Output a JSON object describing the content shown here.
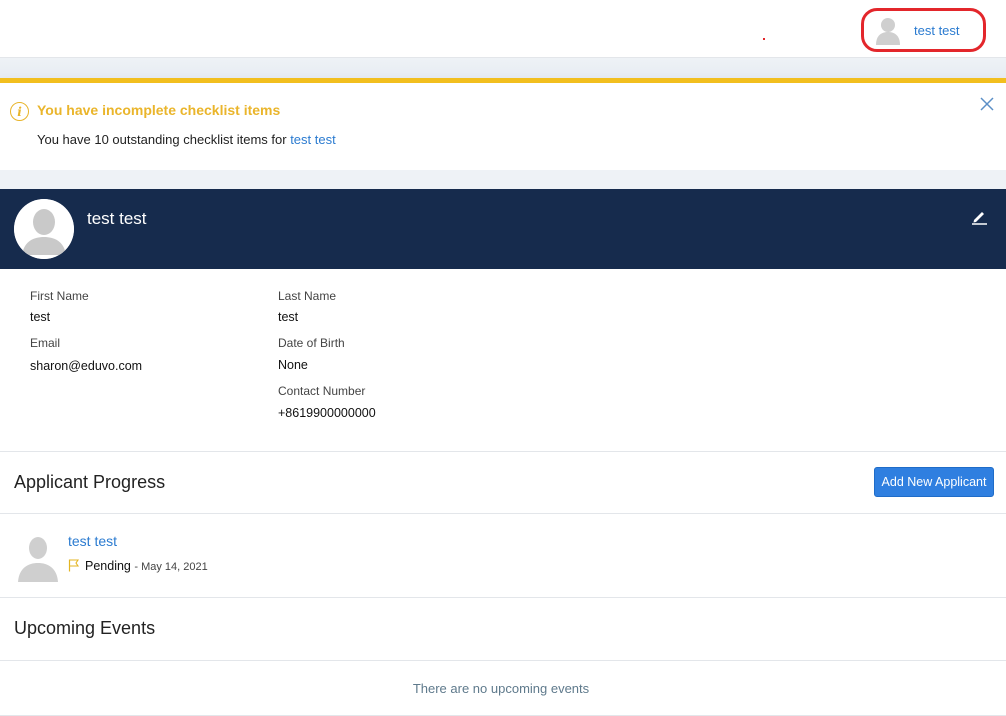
{
  "topbar": {
    "user_name": "test test"
  },
  "alert": {
    "title": "You have incomplete checklist items",
    "message_prefix": "You have 10 outstanding checklist items for",
    "message_link": "test test",
    "info_icon": "i"
  },
  "profile": {
    "name": "test test"
  },
  "details": {
    "first_name_label": "First Name",
    "first_name": "test",
    "last_name_label": "Last Name",
    "last_name": "test",
    "email_label": "Email",
    "email": "sharon@eduvo.com",
    "dob_label": "Date of Birth",
    "dob": "None",
    "contact_label": "Contact Number",
    "contact": "+8619900000000"
  },
  "applicant_progress": {
    "title": "Applicant Progress",
    "add_button": "Add New Applicant",
    "applicants": [
      {
        "name": "test test",
        "status": "Pending",
        "date": "- May 14, 2021"
      }
    ]
  },
  "upcoming_events": {
    "title": "Upcoming Events",
    "empty_text": "There are no upcoming events"
  },
  "colors": {
    "header_bg": "#162b4d",
    "link": "#2b7bd0",
    "alert_accent": "#f2bf1f",
    "primary_button": "#2f7fe0",
    "highlight_ring": "#e3262b"
  }
}
